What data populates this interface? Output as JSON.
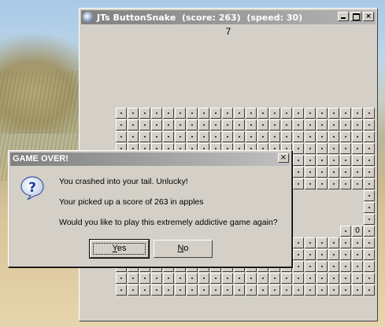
{
  "game_window": {
    "title": "JTs ButtonSnake  (score: 263)  (speed: 30)",
    "counter": "7",
    "cell_label": "0",
    "controls": {
      "minimize_icon": "minimize-icon",
      "maximize_icon": "maximize-icon",
      "close_label": "×"
    }
  },
  "dialog": {
    "title": "GAME OVER!",
    "close_label": "×",
    "icon": "question-icon",
    "lines": [
      "You crashed into your tail. Unlucky!",
      "Your picked up a score of 263 in apples",
      "Would you like to play this extremely addictive game again?"
    ],
    "yes_first": "Y",
    "yes_rest": "es",
    "no_first": "N",
    "no_rest": "o"
  }
}
